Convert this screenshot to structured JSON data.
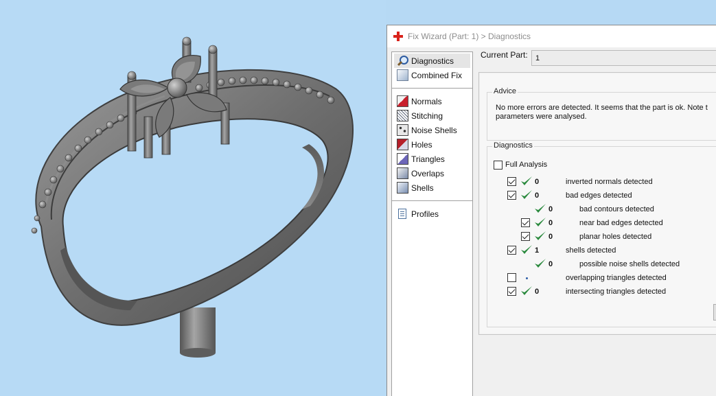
{
  "window": {
    "title": "Fix Wizard (Part: 1) > Diagnostics",
    "app_icon": "red-cross-icon"
  },
  "navigation": {
    "top_items": [
      {
        "label": "Diagnostics",
        "icon": "magnifier-icon",
        "selected": true
      },
      {
        "label": "Combined Fix",
        "icon": "combined-fix-icon",
        "selected": false
      }
    ],
    "fix_items": [
      {
        "label": "Normals",
        "icon": "normals-cube-icon"
      },
      {
        "label": "Stitching",
        "icon": "stitching-cube-icon"
      },
      {
        "label": "Noise Shells",
        "icon": "noise-shells-cube-icon"
      },
      {
        "label": "Holes",
        "icon": "holes-cube-icon"
      },
      {
        "label": "Triangles",
        "icon": "triangles-cube-icon"
      },
      {
        "label": "Overlaps",
        "icon": "overlaps-cube-icon"
      },
      {
        "label": "Shells",
        "icon": "shells-cube-icon"
      }
    ],
    "bottom_items": [
      {
        "label": "Profiles",
        "icon": "document-icon"
      }
    ]
  },
  "current_part": {
    "label": "Current Part:",
    "value": "1"
  },
  "advice": {
    "legend": "Advice",
    "line1": "No more errors are detected. It seems that the part is ok. Note t",
    "line2": "parameters were analysed."
  },
  "diagnostics": {
    "legend": "Diagnostics",
    "full_analysis_label": "Full Analysis",
    "full_analysis_checked": false,
    "rows": [
      {
        "checkbox": true,
        "checked": true,
        "status": "ok",
        "count": "0",
        "label": "inverted normals detected",
        "indent": 0
      },
      {
        "checkbox": true,
        "checked": true,
        "status": "ok",
        "count": "0",
        "label": "bad edges detected",
        "indent": 0
      },
      {
        "checkbox": false,
        "checked": false,
        "status": "ok",
        "count": "0",
        "label": "bad contours detected",
        "indent": 1
      },
      {
        "checkbox": true,
        "checked": true,
        "status": "ok",
        "count": "0",
        "label": "near bad edges detected",
        "indent": 1
      },
      {
        "checkbox": true,
        "checked": true,
        "status": "ok",
        "count": "0",
        "label": "planar holes detected",
        "indent": 1
      },
      {
        "checkbox": true,
        "checked": true,
        "status": "ok",
        "count": "1",
        "label": "shells detected",
        "indent": 0
      },
      {
        "checkbox": false,
        "checked": false,
        "status": "ok",
        "count": "0",
        "label": "possible noise shells detected",
        "indent": 1
      },
      {
        "checkbox": true,
        "checked": false,
        "status": "pending",
        "count": "",
        "label": "overlapping triangles detected",
        "indent": 0
      },
      {
        "checkbox": true,
        "checked": true,
        "status": "ok",
        "count": "0",
        "label": "intersecting triangles detected",
        "indent": 0
      }
    ]
  },
  "colors": {
    "viewport_background": "#b7daf5",
    "model_gray": "#6f6f6f",
    "ok_check": "#2b8a3e"
  }
}
